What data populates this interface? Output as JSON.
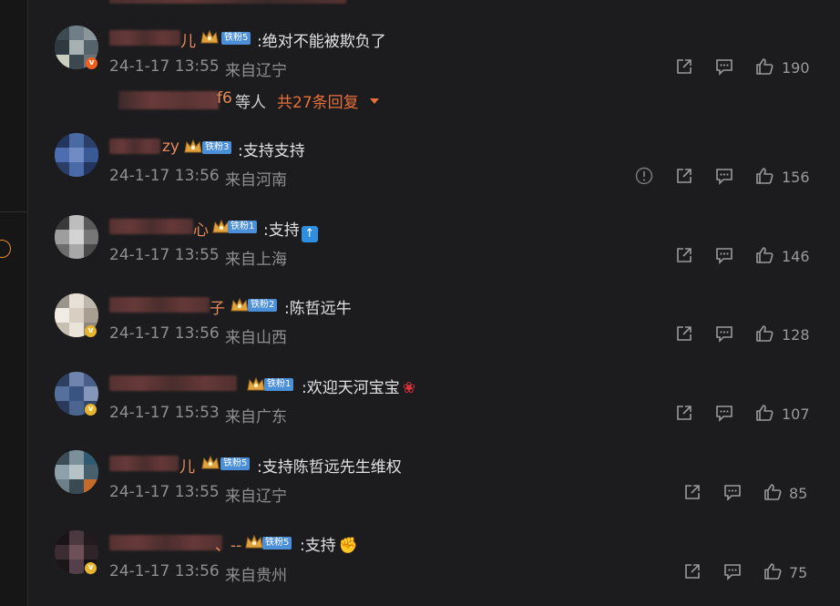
{
  "colors": {
    "accent": "#e8703a",
    "fan_badge": "#4b8fd8",
    "background": "#1c1c1e"
  },
  "reply_summary": {
    "name_tail": "f6",
    "people": "等人",
    "count_label": "共27条回复"
  },
  "comments": [
    {
      "name_tail": "儿",
      "fan_badge": "铁粉5",
      "text": ":绝对不能被欺负了",
      "time": "24-1-17 13:55",
      "location": "来自辽宁",
      "likes": "190",
      "report": false
    },
    {
      "name_tail": "zy",
      "fan_badge": "铁粉3",
      "text": ":支持支持",
      "time": "24-1-17 13:56",
      "location": "来自河南",
      "likes": "156",
      "report": true
    },
    {
      "name_tail": "心",
      "fan_badge": "铁粉1",
      "text": ":支持",
      "time": "24-1-17 13:55",
      "location": "来自上海",
      "likes": "146",
      "report": false
    },
    {
      "name_tail": "子",
      "fan_badge": "铁粉2",
      "text": ":陈哲远牛",
      "time": "24-1-17 13:56",
      "location": "来自山西",
      "likes": "128",
      "report": false
    },
    {
      "name_tail": "",
      "fan_badge": "铁粉1",
      "text": ":欢迎天河宝宝",
      "time": "24-1-17 15:53",
      "location": "来自广东",
      "likes": "107",
      "report": false
    },
    {
      "name_tail": "儿",
      "fan_badge": "铁粉5",
      "text": ":支持陈哲远先生维权",
      "time": "24-1-17 13:55",
      "location": "来自辽宁",
      "likes": "85",
      "report": false
    },
    {
      "name_tail": "、--",
      "fan_badge": "铁粉5",
      "text": ":支持",
      "time": "24-1-17 13:56",
      "location": "来自贵州",
      "likes": "75",
      "report": false
    }
  ],
  "icons": {
    "share": "share-icon",
    "comment": "comment-icon",
    "like": "thumbs-up-icon",
    "report": "report-icon"
  }
}
